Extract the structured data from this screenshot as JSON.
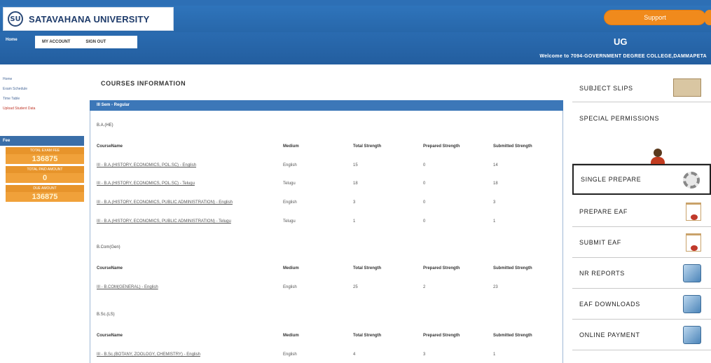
{
  "header": {
    "logo_emblem": "SU",
    "university_name": "SATAVAHANA UNIVERSITY",
    "support_label": "Support",
    "home_label": "Home",
    "menu": [
      "MY ACCOUNT",
      "SIGN OUT"
    ],
    "program": "UG",
    "welcome": "Welcome to 7094-GOVERNMENT DEGREE COLLEGE,DAMMAPETA"
  },
  "sidebar": {
    "links": [
      {
        "label": "Home"
      },
      {
        "label": "Exam Schedule"
      },
      {
        "label": "Time Table"
      },
      {
        "label": "Upload Student Data"
      }
    ],
    "section_label": "Fee",
    "stats": [
      {
        "label": "TOTAL EXAM FEE",
        "value": "136875"
      },
      {
        "label": "TOTAL PAID AMOUNT",
        "value": "0"
      },
      {
        "label": "DUE AMOUNT",
        "value": "136875"
      }
    ]
  },
  "main": {
    "title": "COURSES INFORMATION",
    "panel_header": "III Sem - Regular",
    "columns": [
      "CourseName",
      "Medium",
      "Total Strength",
      "Prepared Strength",
      "Submitted Strength"
    ],
    "groups": [
      {
        "label": "B.A.(HE)",
        "rows": [
          {
            "course": "III - B.A.(HISTORY, ECONOMICS, POL.SC) - English",
            "medium": "English",
            "total": "15",
            "prepared": "0",
            "submitted": "14"
          },
          {
            "course": "III - B.A.(HISTORY, ECONOMICS, POL.SC) - Telugu",
            "medium": "Telugu",
            "total": "18",
            "prepared": "0",
            "submitted": "18"
          },
          {
            "course": "III - B.A.(HISTORY, ECONOMICS, PUBLIC ADMINISTRATION) - English",
            "medium": "English",
            "total": "3",
            "prepared": "0",
            "submitted": "3"
          },
          {
            "course": "III - B.A.(HISTORY, ECONOMICS, PUBLIC ADMINISTRATION) - Telugu",
            "medium": "Telugu",
            "total": "1",
            "prepared": "0",
            "submitted": "1"
          }
        ]
      },
      {
        "label": "B.Com(Gen)",
        "rows": [
          {
            "course": "III - B.COM(GENERAL) - English",
            "medium": "English",
            "total": "25",
            "prepared": "2",
            "submitted": "23"
          }
        ]
      },
      {
        "label": "B.Sc.(LS)",
        "rows": [
          {
            "course": "III - B.Sc.(BOTANY, ZOOLOGY, CHEMISTRY) - English",
            "medium": "English",
            "total": "4",
            "prepared": "3",
            "submitted": "1"
          }
        ]
      }
    ]
  },
  "right_menu": {
    "items": [
      {
        "label": "SUBJECT SLIPS",
        "icon": "folder-icon"
      },
      {
        "label": "SPECIAL PERMISSIONS",
        "icon": "person-icon"
      },
      {
        "label": "SINGLE PREPARE",
        "icon": "gear-icon"
      },
      {
        "label": "PREPARE EAF",
        "icon": "document-icon"
      },
      {
        "label": "SUBMIT EAF",
        "icon": "document-icon"
      },
      {
        "label": "NR REPORTS",
        "icon": "cube-icon"
      },
      {
        "label": "EAF DOWNLOADS",
        "icon": "cube-icon"
      },
      {
        "label": "ONLINE PAYMENT",
        "icon": "cube-icon"
      }
    ]
  },
  "colors": {
    "header_blue": "#2d6fb5",
    "panel_blue": "#3c77b8",
    "support_orange": "#f08a1c",
    "stat_orange": "#f0a13a"
  }
}
